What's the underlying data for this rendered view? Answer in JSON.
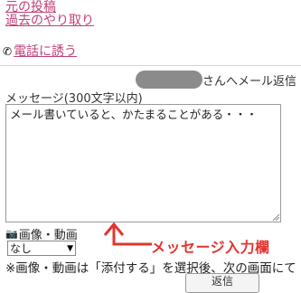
{
  "nav": {
    "original_post_link": "元の投稿",
    "history_link": "過去のやり取り"
  },
  "call": {
    "icon": "phone-icon",
    "label": "電話に誘う"
  },
  "reply": {
    "suffix": "さんへメール返信"
  },
  "message": {
    "label": "メッセージ(300文字以内)",
    "value": "メール書いていると、かたまることがある・・・"
  },
  "media": {
    "image_icon": "camera-icon",
    "video_icon": "video-icon",
    "label": "画像・動画",
    "selected": "なし"
  },
  "note": "※画像・動画は「添付する」を選択後、次の画面にて",
  "bottom_button": "返信",
  "annotation": {
    "text": "メッセージ入力欄",
    "color": "#e3342f"
  },
  "colors": {
    "link": "#c0407a",
    "divider": "#f3c6c6"
  }
}
